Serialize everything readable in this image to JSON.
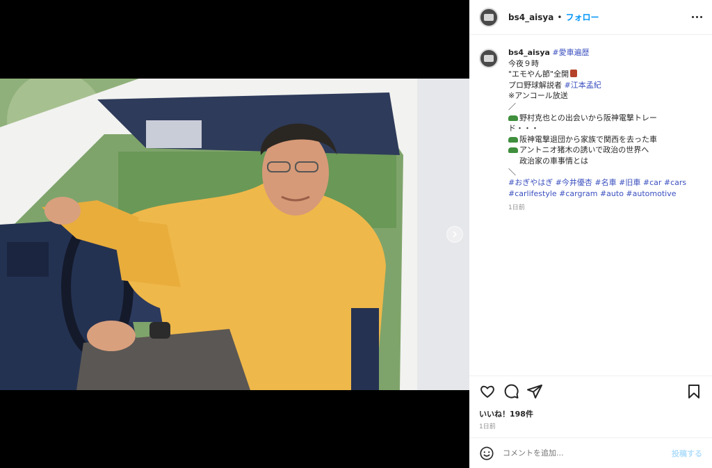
{
  "post": {
    "username": "bs4_aisya",
    "separator": "•",
    "follow_label": "フォロー",
    "more_icon": "more-horizontal-icon",
    "photo_description_icon": "photo",
    "next_icon": "chevron-right-icon"
  },
  "caption": {
    "username": "bs4_aisya",
    "hashtag_top": "#愛車遍歴",
    "line1": "今夜９時",
    "line2": "\"エモやん節\"全開",
    "line3_prefix": "プロ野球解説者",
    "line3_tag": "#江本孟紀",
    "line4": "※アンコール放送",
    "slash_open": "／",
    "item1": "野村克也との出会いから阪神電撃トレー",
    "item1b": "ド・・・",
    "item2": "阪神電撃退団から家族で関西を去った車",
    "item3": "アントニオ猪木の誘いで政治の世界へ",
    "item3b": "政治家の車事情とは",
    "slash_close": "＼",
    "tags_line1": "#おぎやはぎ #今井優杏 #名車 #旧車 #car #cars",
    "tags_line2": "#carlifestyle #cargram #auto #automotive",
    "time": "1日前"
  },
  "actions": {
    "icons": [
      "heart-icon",
      "comment-icon",
      "share-icon",
      "bookmark-icon"
    ],
    "likes": "いいね！198件",
    "time": "1日前"
  },
  "comment": {
    "placeholder": "コメントを追加...",
    "post_label": "投稿する"
  },
  "colors": {
    "link": "#3a4fbf",
    "follow": "#0095f6",
    "post_disabled": "#b2dffc"
  }
}
